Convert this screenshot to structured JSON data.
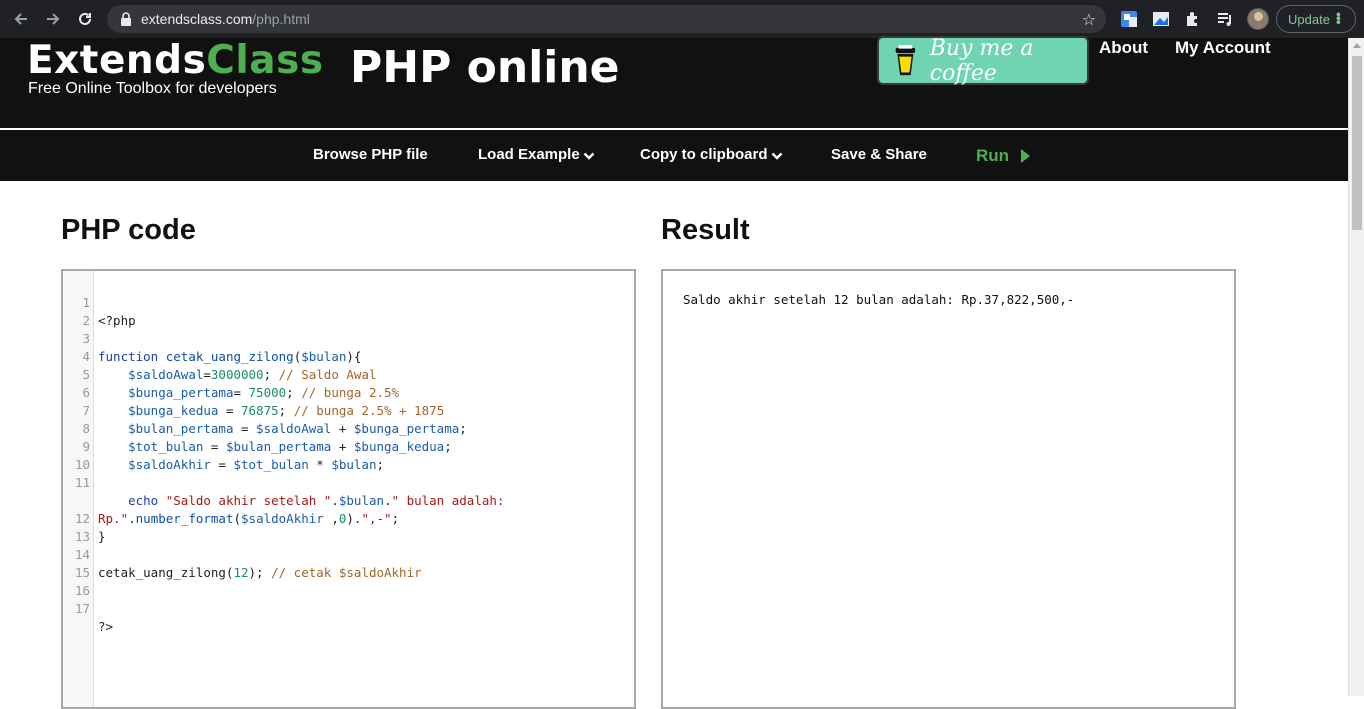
{
  "browser": {
    "url_domain": "extendsclass.com",
    "url_path": "/php.html",
    "update_label": "Update"
  },
  "header": {
    "logo_primary": "Extends",
    "logo_accent": "Class",
    "tagline": "Free Online Toolbox for developers",
    "page_title": "PHP online",
    "coffee_label": "Buy me a coffee",
    "links": [
      "About",
      "My Account"
    ]
  },
  "toolbar": {
    "browse_label": "Browse PHP file",
    "load_example_label": "Load Example",
    "copy_label": "Copy to clipboard",
    "save_share_label": "Save & Share",
    "run_label": "Run"
  },
  "panels": {
    "code_title": "PHP code",
    "result_title": "Result"
  },
  "code": {
    "line_numbers": [
      "1",
      "2",
      "3",
      "4",
      "5",
      "6",
      "7",
      "8",
      "9",
      "10",
      "11",
      "",
      "12",
      "13",
      "14",
      "15",
      "16",
      "17"
    ],
    "l1": "<?php",
    "l3_kw": "function",
    "l3_fn": "cetak_uang_zilong",
    "l3_open": "(",
    "l3_var": "$bulan",
    "l3_close": "){",
    "l4_var": "$saldoAwal",
    "l4_op": "=",
    "l4_num": "3000000",
    "l4_semi": "; ",
    "l4_cm": "// Saldo Awal",
    "l5_var": "$bunga_pertama",
    "l5_op": "= ",
    "l5_num": "75000",
    "l5_semi": "; ",
    "l5_cm": "// bunga 2.5%",
    "l6_var": "$bunga_kedua",
    "l6_op": " = ",
    "l6_num": "76875",
    "l6_semi": "; ",
    "l6_cm": "// bunga 2.5% + 1875",
    "l7_var1": "$bulan_pertama",
    "l7_op1": " = ",
    "l7_var2": "$saldoAwal",
    "l7_op2": " + ",
    "l7_var3": "$bunga_pertama",
    "l7_semi": ";",
    "l8_var1": "$tot_bulan",
    "l8_op1": " = ",
    "l8_var2": "$bulan_pertama",
    "l8_op2": " + ",
    "l8_var3": "$bunga_kedua",
    "l8_semi": ";",
    "l9_var1": "$saldoAkhir",
    "l9_op1": " = ",
    "l9_var2": "$tot_bulan",
    "l9_op2": " * ",
    "l9_var3": "$bulan",
    "l9_semi": ";",
    "l11_kw": "echo",
    "l11_str1": " \"Saldo akhir setelah \"",
    "l11_dot1": ".",
    "l11_var": "$bulan",
    "l11_dot2": ".",
    "l11_str2": "\" bulan adalah:",
    "l11b_str": "Rp.\"",
    "l11b_dot": ".",
    "l11b_fn": "number_format",
    "l11b_open": "(",
    "l11b_var": "$saldoAkhir",
    "l11b_comma": " ,",
    "l11b_num": "0",
    "l11b_close": ").",
    "l11b_str2": "\",-\"",
    "l11b_semi": ";",
    "l12": "}",
    "l14_call": "cetak_uang_zilong(",
    "l14_num": "12",
    "l14_close": "); ",
    "l14_cm": "// cetak $saldoAkhir",
    "l17": "?>"
  },
  "result": {
    "output": "Saldo akhir setelah 12 bulan adalah: Rp.37,822,500,-"
  },
  "colors": {
    "accent_green": "#4caf50",
    "coffee_bg": "#6fd4b0",
    "header_bg": "#111111"
  }
}
